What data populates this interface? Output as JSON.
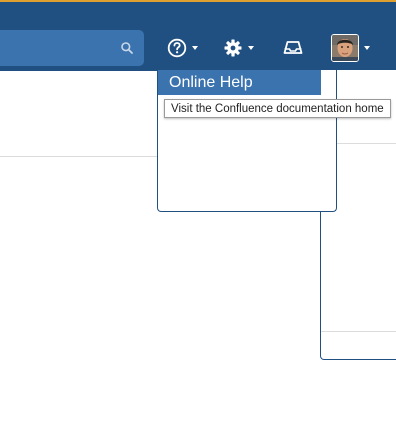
{
  "header": {
    "search_icon": "search-icon",
    "help_icon": "help-icon",
    "settings_icon": "gear-icon",
    "notifications_icon": "inbox-icon",
    "avatar_icon": "user-avatar"
  },
  "help_menu": {
    "item_label": "Online Help"
  },
  "tooltip": {
    "text": "Visit the Confluence documentation home"
  },
  "colors": {
    "header_bg": "#205081",
    "accent": "#3b73af",
    "header_top_stripe": "#e0a030"
  }
}
